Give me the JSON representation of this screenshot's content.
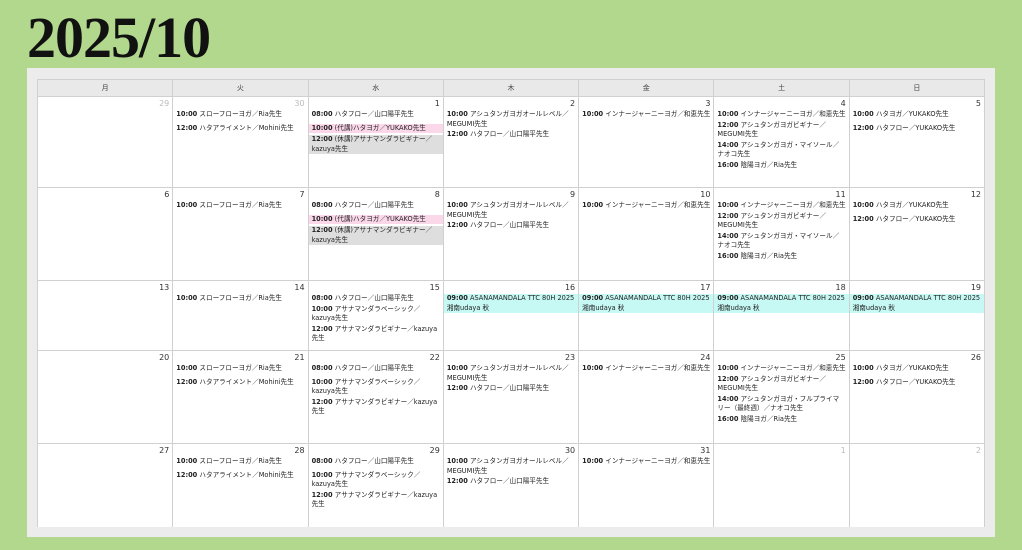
{
  "title": "2025/10",
  "weekdays": [
    "月",
    "火",
    "水",
    "木",
    "金",
    "土",
    "日"
  ],
  "weeks": [
    [
      {
        "day": "29",
        "other": true,
        "events": []
      },
      {
        "day": "30",
        "other": true,
        "events": [
          {
            "time": "10:00",
            "text": "スローフローヨガ／Ria先生"
          },
          {
            "time": "12:00",
            "text": "ハタアライメント／Mohini先生"
          }
        ]
      },
      {
        "day": "1",
        "events": [
          {
            "time": "08:00",
            "text": "ハタフロー／山口陽平先生"
          },
          {
            "time": "10:00",
            "text": "(代講)ハタヨガ／YUKAKO先生",
            "style": "pink"
          },
          {
            "time": "12:00",
            "text": "(休講)アサナマンダラビギナー／kazuya先生",
            "style": "gray"
          }
        ]
      },
      {
        "day": "2",
        "events": [
          {
            "time": "10:00",
            "text": "アシュタンガヨガオールレベル／MEGUMI先生",
            "style": "gap0"
          },
          {
            "time": "12:00",
            "text": "ハタフロー／山口陽平先生"
          }
        ]
      },
      {
        "day": "3",
        "events": [
          {
            "time": "10:00",
            "text": "インナージャーニーヨガ／和恵先生"
          }
        ]
      },
      {
        "day": "4",
        "events": [
          {
            "time": "10:00",
            "text": "インナージャーニーヨガ／和恵先生",
            "style": "gap0"
          },
          {
            "time": "12:00",
            "text": "アシュタンガヨガビギナー／MEGUMI先生",
            "style": "gap0"
          },
          {
            "time": "14:00",
            "text": "アシュタンガヨガ・マイソール／ナオコ先生",
            "style": "gap0"
          },
          {
            "time": "16:00",
            "text": "陰陽ヨガ／Ria先生"
          }
        ]
      },
      {
        "day": "5",
        "events": [
          {
            "time": "10:00",
            "text": "ハタヨガ／YUKAKO先生"
          },
          {
            "time": "12:00",
            "text": "ハタフロー／YUKAKO先生"
          }
        ]
      }
    ],
    [
      {
        "day": "6",
        "events": []
      },
      {
        "day": "7",
        "events": [
          {
            "time": "10:00",
            "text": "スローフローヨガ／Ria先生"
          }
        ]
      },
      {
        "day": "8",
        "events": [
          {
            "time": "08:00",
            "text": "ハタフロー／山口陽平先生"
          },
          {
            "time": "10:00",
            "text": "(代講)ハタヨガ／YUKAKO先生",
            "style": "pink"
          },
          {
            "time": "12:00",
            "text": "(休講)アサナマンダラビギナー／kazuya先生",
            "style": "gray"
          }
        ]
      },
      {
        "day": "9",
        "events": [
          {
            "time": "10:00",
            "text": "アシュタンガヨガオールレベル／MEGUMI先生",
            "style": "gap0"
          },
          {
            "time": "12:00",
            "text": "ハタフロー／山口陽平先生"
          }
        ]
      },
      {
        "day": "10",
        "events": [
          {
            "time": "10:00",
            "text": "インナージャーニーヨガ／和恵先生"
          }
        ]
      },
      {
        "day": "11",
        "events": [
          {
            "time": "10:00",
            "text": "インナージャーニーヨガ／和恵先生",
            "style": "gap0"
          },
          {
            "time": "12:00",
            "text": "アシュタンガヨガビギナー／MEGUMI先生",
            "style": "gap0"
          },
          {
            "time": "14:00",
            "text": "アシュタンガヨガ・マイソール／ナオコ先生",
            "style": "gap0"
          },
          {
            "time": "16:00",
            "text": "陰陽ヨガ／Ria先生"
          }
        ]
      },
      {
        "day": "12",
        "events": [
          {
            "time": "10:00",
            "text": "ハタヨガ／YUKAKO先生"
          },
          {
            "time": "12:00",
            "text": "ハタフロー／YUKAKO先生"
          }
        ]
      }
    ],
    [
      {
        "day": "13",
        "events": []
      },
      {
        "day": "14",
        "events": [
          {
            "time": "10:00",
            "text": "スローフローヨガ／Ria先生"
          }
        ]
      },
      {
        "day": "15",
        "events": [
          {
            "time": "08:00",
            "text": "ハタフロー／山口陽平先生",
            "style": "gap0"
          },
          {
            "time": "10:00",
            "text": "アサナマンダラベーシック／kazuya先生",
            "style": "gap0"
          },
          {
            "time": "12:00",
            "text": "アサナマンダラビギナー／kazuya先生"
          }
        ]
      },
      {
        "day": "16",
        "events": [
          {
            "time": "09:00",
            "text": "ASANAMANDALA TTC 80H 2025 湘南udaya 秋",
            "style": "cyan"
          }
        ]
      },
      {
        "day": "17",
        "events": [
          {
            "time": "09:00",
            "text": "ASANAMANDALA TTC 80H 2025 湘南udaya 秋",
            "style": "cyan"
          }
        ]
      },
      {
        "day": "18",
        "events": [
          {
            "time": "09:00",
            "text": "ASANAMANDALA TTC 80H 2025 湘南udaya 秋",
            "style": "cyan"
          }
        ]
      },
      {
        "day": "19",
        "events": [
          {
            "time": "09:00",
            "text": "ASANAMANDALA TTC 80H 2025 湘南udaya 秋",
            "style": "cyan"
          }
        ]
      }
    ],
    [
      {
        "day": "20",
        "events": []
      },
      {
        "day": "21",
        "events": [
          {
            "time": "10:00",
            "text": "スローフローヨガ／Ria先生"
          },
          {
            "time": "12:00",
            "text": "ハタアライメント／Mohini先生"
          }
        ]
      },
      {
        "day": "22",
        "events": [
          {
            "time": "08:00",
            "text": "ハタフロー／山口陽平先生"
          },
          {
            "time": "10:00",
            "text": "アサナマンダラベーシック／kazuya先生",
            "style": "gap0"
          },
          {
            "time": "12:00",
            "text": "アサナマンダラビギナー／kazuya先生"
          }
        ]
      },
      {
        "day": "23",
        "events": [
          {
            "time": "10:00",
            "text": "アシュタンガヨガオールレベル／MEGUMI先生",
            "style": "gap0"
          },
          {
            "time": "12:00",
            "text": "ハタフロー／山口陽平先生"
          }
        ]
      },
      {
        "day": "24",
        "events": [
          {
            "time": "10:00",
            "text": "インナージャーニーヨガ／和恵先生"
          }
        ]
      },
      {
        "day": "25",
        "events": [
          {
            "time": "10:00",
            "text": "インナージャーニーヨガ／和恵先生",
            "style": "gap0"
          },
          {
            "time": "12:00",
            "text": "アシュタンガヨガビギナー／MEGUMI先生",
            "style": "gap0"
          },
          {
            "time": "14:00",
            "text": "アシュタンガヨガ・フルプライマリー（最終週）／ナオコ先生",
            "style": "gap0"
          },
          {
            "time": "16:00",
            "text": "陰陽ヨガ／Ria先生"
          }
        ]
      },
      {
        "day": "26",
        "events": [
          {
            "time": "10:00",
            "text": "ハタヨガ／YUKAKO先生"
          },
          {
            "time": "12:00",
            "text": "ハタフロー／YUKAKO先生"
          }
        ]
      }
    ],
    [
      {
        "day": "27",
        "events": []
      },
      {
        "day": "28",
        "events": [
          {
            "time": "10:00",
            "text": "スローフローヨガ／Ria先生"
          },
          {
            "time": "12:00",
            "text": "ハタアライメント／Mohini先生"
          }
        ]
      },
      {
        "day": "29",
        "events": [
          {
            "time": "08:00",
            "text": "ハタフロー／山口陽平先生"
          },
          {
            "time": "10:00",
            "text": "アサナマンダラベーシック／kazuya先生",
            "style": "gap0"
          },
          {
            "time": "12:00",
            "text": "アサナマンダラビギナー／kazuya先生"
          }
        ]
      },
      {
        "day": "30",
        "events": [
          {
            "time": "10:00",
            "text": "アシュタンガヨガオールレベル／MEGUMI先生",
            "style": "gap0"
          },
          {
            "time": "12:00",
            "text": "ハタフロー／山口陽平先生"
          }
        ]
      },
      {
        "day": "31",
        "events": [
          {
            "time": "10:00",
            "text": "インナージャーニーヨガ／和恵先生"
          }
        ]
      },
      {
        "day": "1",
        "other": true,
        "events": []
      },
      {
        "day": "2",
        "other": true,
        "events": []
      }
    ]
  ]
}
